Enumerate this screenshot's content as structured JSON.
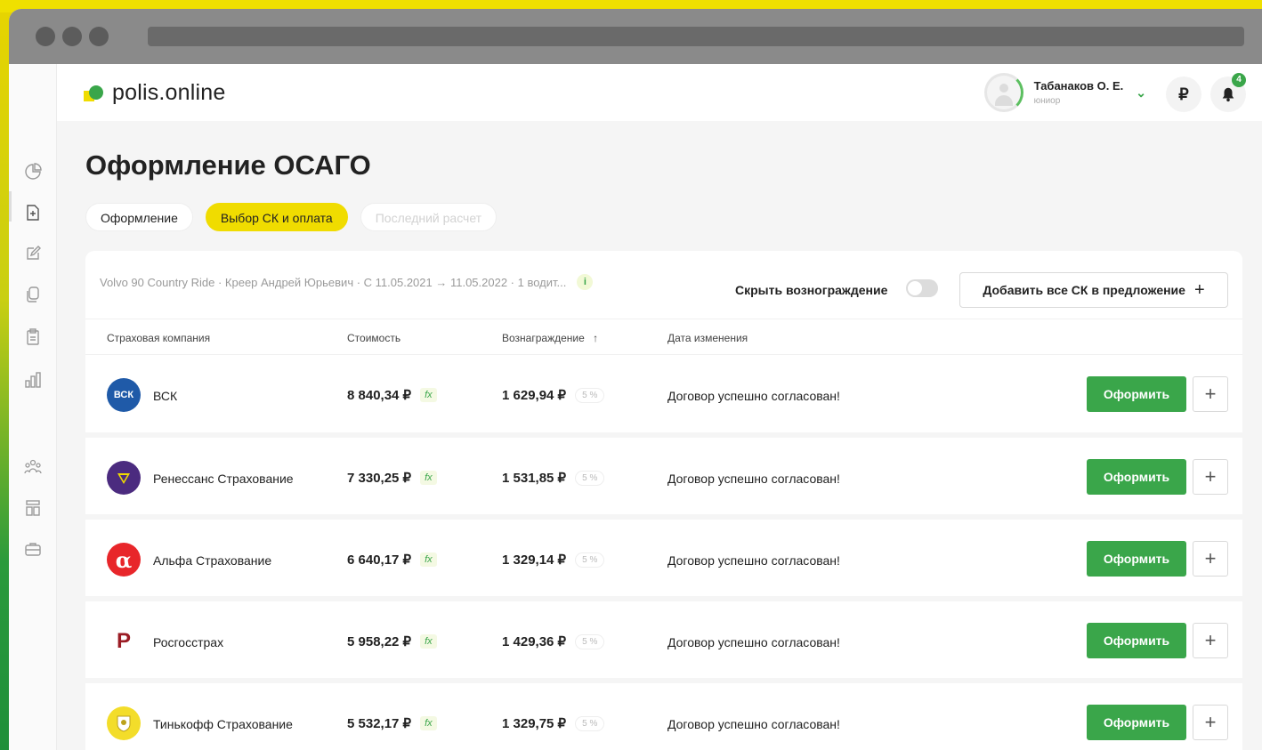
{
  "app": {
    "logo_text": "polis.online",
    "colors": {
      "accent_green": "#3aa64a",
      "accent_yellow": "#f0dc00"
    }
  },
  "user": {
    "name": "Табанаков О. Е.",
    "role": "юниор",
    "currency_symbol": "₽",
    "notifications": "4"
  },
  "page": {
    "title": "Оформление ОСАГО",
    "tabs": [
      {
        "label": "Оформление",
        "state": "default"
      },
      {
        "label": "Выбор СК и оплата",
        "state": "active"
      },
      {
        "label": "Последний расчет",
        "state": "disabled"
      }
    ]
  },
  "toolbar": {
    "summary": "Volvo 90 Country Ride · Креер Андрей Юрьевич · С 11.05.2021 → 11.05.2022 · 1 водит...",
    "info_icon": "i",
    "hide_reward_label": "Скрыть вознограждение",
    "hide_reward_on": false,
    "add_all_label": "Добавить все СК в предложение"
  },
  "table": {
    "headers": [
      "Страховая компания",
      "Стоимость",
      "Вознаграждение",
      "Дата изменения"
    ],
    "sort_indicator": "↑",
    "rows": [
      {
        "company": "ВСК",
        "logo_text": "ВСК",
        "logo_color": "#1f5aa8",
        "price": "8 840,34 ₽",
        "reward": "1 629,94 ₽",
        "reward_pct": "5 %",
        "status": "Договор успешно согласован!",
        "action": "Оформить"
      },
      {
        "company": "Ренессанс Страхование",
        "logo_text": "",
        "logo_color": "#4b2b7f",
        "price": "7 330,25 ₽",
        "reward": "1 531,85 ₽",
        "reward_pct": "5 %",
        "status": "Договор успешно согласован!",
        "action": "Оформить"
      },
      {
        "company": "Альфа Страхование",
        "logo_text": "α",
        "logo_color": "#e8262a",
        "price": "6 640,17 ₽",
        "reward": "1 329,14 ₽",
        "reward_pct": "5 %",
        "status": "Договор успешно согласован!",
        "action": "Оформить"
      },
      {
        "company": "Росгосстрах",
        "logo_text": "Р",
        "logo_color": "#ffffff",
        "price": "5 958,22 ₽",
        "reward": "1 429,36 ₽",
        "reward_pct": "5 %",
        "status": "Договор успешно согласован!",
        "action": "Оформить"
      },
      {
        "company": "Тинькофф Страхование",
        "logo_text": "",
        "logo_color": "#f3dd2a",
        "price": "5 532,17 ₽",
        "reward": "1 329,75 ₽",
        "reward_pct": "5 %",
        "status": "Договор успешно согласован!",
        "action": "Оформить"
      }
    ],
    "fx_label": "fx"
  }
}
